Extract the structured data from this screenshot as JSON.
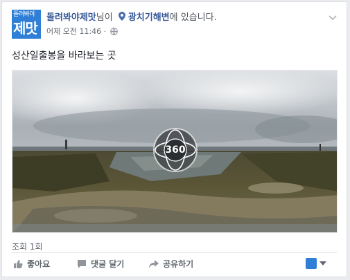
{
  "post": {
    "logo_line1": "돌려봐야",
    "logo_line2": "제맛",
    "page_name": "돌려봐야제맛",
    "name_suffix": "님이",
    "location": "광치기해변",
    "location_suffix": "에 있습니다.",
    "timestamp": "어제 오전 11:46 · ",
    "privacy_icon": "globe-icon",
    "caption": "성산일출봉을 바라보는 곳",
    "badge_360": "360",
    "views": "조회 1회"
  },
  "actions": {
    "like": "좋아요",
    "comment": "댓글 달기",
    "share": "공유하기"
  },
  "colors": {
    "link": "#365899",
    "logo_bg": "#2f7fd6",
    "muted": "#616770"
  }
}
